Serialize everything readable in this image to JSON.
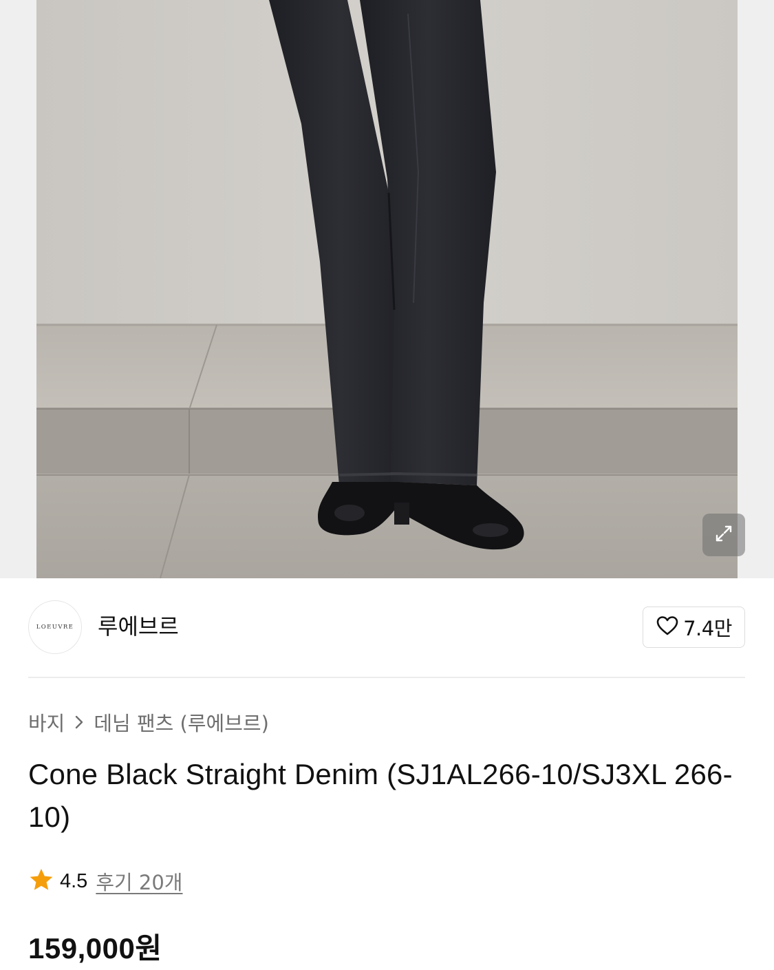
{
  "brand": {
    "logo_text": "LOEUVRE",
    "name": "루에브르"
  },
  "like": {
    "icon": "heart-outline-icon",
    "count": "7.4만"
  },
  "breadcrumb": {
    "items": [
      "바지",
      "데님 팬츠 (루에브르)"
    ],
    "separator_icon": "chevron-right-icon"
  },
  "product": {
    "title": "Cone Black Straight Denim (SJ1AL266-10/SJ3XL 266-10)",
    "rating": "4.5",
    "reviews_label": "후기 20개",
    "price": "159,000원"
  },
  "photo": {
    "expand_icon": "expand-arrows-icon"
  },
  "colors": {
    "star": "#f59e0b",
    "text_primary": "#111111",
    "text_secondary": "#6e6e6e",
    "divider": "#ececec"
  }
}
